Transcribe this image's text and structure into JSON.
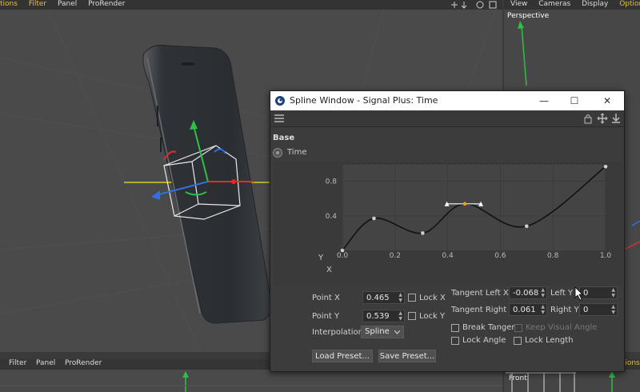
{
  "top_menu": {
    "items": [
      "tions",
      "Filter",
      "Panel",
      "ProRender"
    ]
  },
  "right_menu": {
    "items": [
      "View",
      "Cameras",
      "Display",
      "Options"
    ]
  },
  "right_viewport": {
    "label": "Perspective"
  },
  "bottom_menu": {
    "items": [
      "Filter",
      "Panel",
      "ProRender"
    ],
    "right_item": "Options"
  },
  "front_viewport": {
    "label": "Front"
  },
  "window": {
    "title": "Spline Window - Signal Plus: Time",
    "minimize_glyph": "—",
    "maximize_glyph": "☐",
    "close_glyph": "✕"
  },
  "panel": {
    "section": "Base",
    "curve_name": "Time"
  },
  "chart_data": {
    "type": "line",
    "x": [
      0.0,
      0.12,
      0.305,
      0.465,
      0.7,
      1.0
    ],
    "y": [
      0.0,
      0.37,
      0.2,
      0.539,
      0.28,
      0.97
    ],
    "selected_index": 3,
    "xlim": [
      0,
      1
    ],
    "ylim": [
      0,
      1
    ],
    "x_ticks": [
      "0.0",
      "0.2",
      "0.4",
      "0.6",
      "0.8",
      "1.0"
    ],
    "y_ticks": [
      "0.4",
      "0.8"
    ],
    "xlabel": "X",
    "ylabel": "Y",
    "colors": {
      "curve": "#111111",
      "point": "#cfcfcf",
      "selected": "#e8a020",
      "tangent": "#ffffff"
    }
  },
  "fields": {
    "point_x": {
      "label": "Point X",
      "value": "0.465",
      "lock_label": "Lock X"
    },
    "point_y": {
      "label": "Point Y",
      "value": "0.539",
      "lock_label": "Lock Y"
    },
    "interpolation": {
      "label": "Interpolation",
      "value": "Spline"
    },
    "tangent_left_x": {
      "label": "Tangent Left X",
      "value": "-0.068"
    },
    "left_y": {
      "label": "Left Y",
      "value": "0"
    },
    "tangent_right_x": {
      "label": "Tangent Right X",
      "value": "0.061"
    },
    "right_y": {
      "label": "Right Y",
      "value": "0"
    },
    "break_tangent": "Break Tangent",
    "keep_visual_angle": "Keep Visual Angle",
    "lock_angle": "Lock Angle",
    "lock_length": "Lock Length"
  },
  "buttons": {
    "load_preset": "Load Preset...",
    "save_preset": "Save Preset..."
  }
}
